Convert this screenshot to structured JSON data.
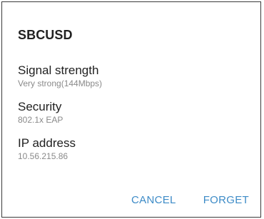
{
  "dialog": {
    "title": "SBCUSD",
    "fields": [
      {
        "label": "Signal strength",
        "value": "Very strong(144Mbps)"
      },
      {
        "label": "Security",
        "value": "802.1x EAP"
      },
      {
        "label": "IP address",
        "value": "10.56.215.86"
      }
    ],
    "actions": {
      "cancel_label": "CANCEL",
      "forget_label": "FORGET"
    }
  }
}
